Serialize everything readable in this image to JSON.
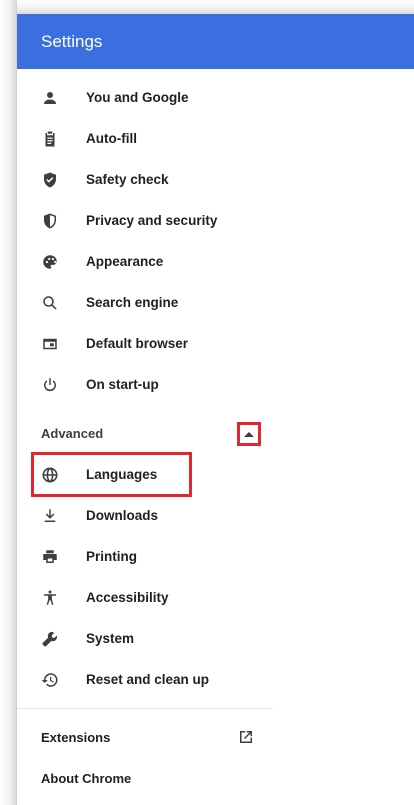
{
  "header": {
    "title": "Settings"
  },
  "menu": {
    "items": [
      {
        "label": "You and Google",
        "icon": "person-icon"
      },
      {
        "label": "Auto-fill",
        "icon": "clipboard-icon"
      },
      {
        "label": "Safety check",
        "icon": "shield-check-icon"
      },
      {
        "label": "Privacy and security",
        "icon": "shield-icon"
      },
      {
        "label": "Appearance",
        "icon": "palette-icon"
      },
      {
        "label": "Search engine",
        "icon": "search-icon"
      },
      {
        "label": "Default browser",
        "icon": "browser-window-icon"
      },
      {
        "label": "On start-up",
        "icon": "power-icon"
      }
    ],
    "advanced_label": "Advanced",
    "advanced_items": [
      {
        "label": "Languages",
        "icon": "globe-icon"
      },
      {
        "label": "Downloads",
        "icon": "download-icon"
      },
      {
        "label": "Printing",
        "icon": "printer-icon"
      },
      {
        "label": "Accessibility",
        "icon": "accessibility-icon"
      },
      {
        "label": "System",
        "icon": "wrench-icon"
      },
      {
        "label": "Reset and clean up",
        "icon": "restore-icon"
      }
    ],
    "extensions_label": "Extensions",
    "about_label": "About Chrome"
  },
  "colors": {
    "header": "#3b6fe0",
    "highlight": "#e5262f"
  }
}
